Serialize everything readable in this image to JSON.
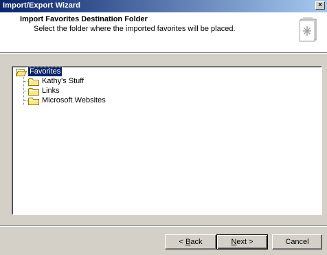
{
  "window": {
    "title": "Import/Export Wizard",
    "close_glyph": "×"
  },
  "header": {
    "title": "Import Favorites Destination Folder",
    "subtitle": "Select the folder where the imported favorites will be placed.",
    "icon": "wizard-page-icon"
  },
  "tree": {
    "root": {
      "label": "Favorites",
      "selected": true,
      "icon": "folder-open-icon"
    },
    "children": [
      {
        "label": "Kathy's Stuff",
        "icon": "folder-icon"
      },
      {
        "label": "Links",
        "icon": "folder-icon"
      },
      {
        "label": "Microsoft Websites",
        "icon": "folder-icon"
      }
    ]
  },
  "buttons": {
    "back": {
      "pre": "< ",
      "mnemonic": "B",
      "rest": "ack"
    },
    "next": {
      "mnemonic": "N",
      "rest": "ext >"
    },
    "cancel": "Cancel"
  },
  "colors": {
    "titlebar_start": "#0a246a",
    "titlebar_end": "#a6caf0",
    "face": "#d4d0c8",
    "selection": "#0a246a"
  }
}
